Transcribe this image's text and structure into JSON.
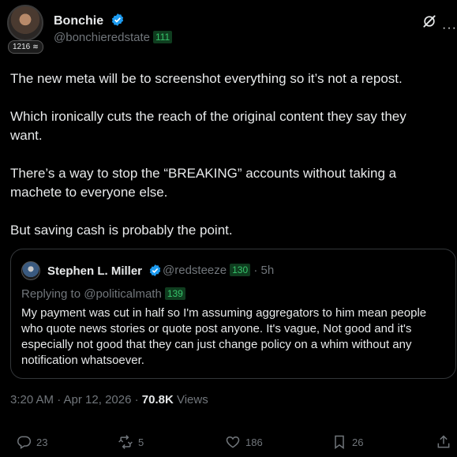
{
  "author": {
    "name": "Bonchie",
    "handle": "@bonchieredstate",
    "handle_badge": "111",
    "level_badge": "1216"
  },
  "post": {
    "paragraphs": [
      "The new meta will be to screenshot everything so it’s not a repost.",
      "Which ironically cuts the reach of the original content they say they want.",
      "There’s a way to stop the “BREAKING” accounts without taking a machete to everyone else.",
      "But saving cash is probably the point."
    ]
  },
  "quote": {
    "name": "Stephen L. Miller",
    "handle": "@redsteeze",
    "handle_badge": "130",
    "time": "· 5h",
    "replying_label": "Replying to @politicalmath",
    "replying_badge": "139",
    "text": "My payment was cut in half so I'm assuming aggregators to him mean people who quote news stories or quote post anyone. It's vague, Not good and it's especially not good that they can just change policy on a whim without any notification whatsoever."
  },
  "meta": {
    "time": "3:20 AM · Apr 12, 2026 · ",
    "views_count": "70.8K",
    "views_label": " Views"
  },
  "actions": {
    "replies": "23",
    "reposts": "5",
    "likes": "186",
    "bookmarks": "26"
  },
  "colors": {
    "background": "#000000",
    "text": "#e7e9ea",
    "muted": "#71767b",
    "verified": "#1d9bf0",
    "badge_green": "#36c36a"
  },
  "icons": [
    "verified-icon",
    "grok-icon",
    "more-icon",
    "reply-icon",
    "repost-icon",
    "like-icon",
    "bookmark-icon",
    "share-icon"
  ]
}
